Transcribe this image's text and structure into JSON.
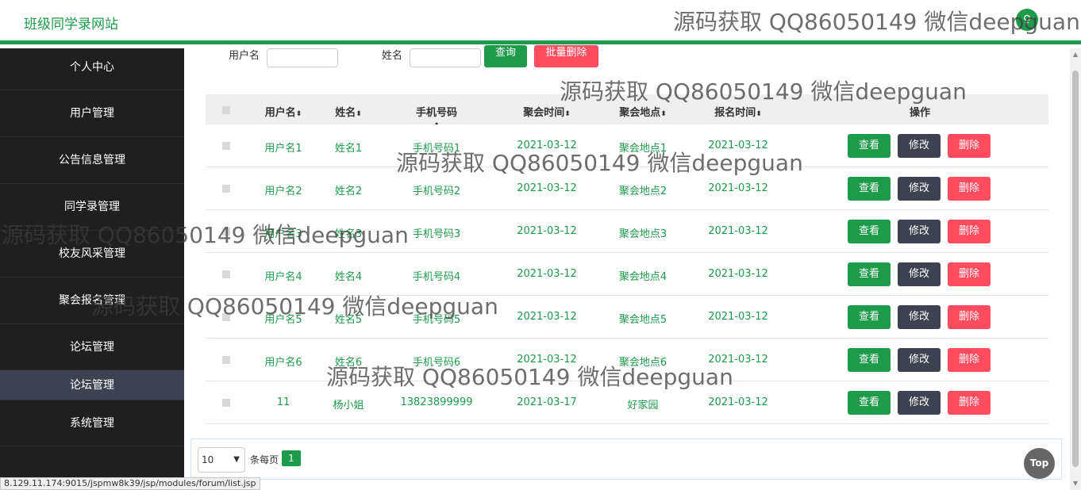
{
  "header": {
    "site_title": "班级同学录网站",
    "avatar_glyph": "♀"
  },
  "sidebar": {
    "items": [
      {
        "label": "个人中心"
      },
      {
        "label": "用户管理"
      },
      {
        "label": "公告信息管理"
      },
      {
        "label": "同学录管理"
      },
      {
        "label": "校友风采管理"
      },
      {
        "label": "聚会报名管理"
      },
      {
        "label": "论坛管理"
      },
      {
        "label": "论坛管理",
        "sub": true
      },
      {
        "label": "系统管理"
      }
    ]
  },
  "search": {
    "username_label": "用户名",
    "name_label": "姓名",
    "username_value": "",
    "name_value": "",
    "query_button": "查询",
    "batch_delete_button": "批量删除"
  },
  "table": {
    "headers": [
      "用户名",
      "姓名",
      "手机号码",
      "聚会时间",
      "聚会地点",
      "报名时间",
      "操作"
    ],
    "sort_icon": "sort-icon",
    "rows": [
      [
        "用户名1",
        "姓名1",
        "手机号码1",
        "2021-03-12",
        "聚会地点1",
        "2021-03-12"
      ],
      [
        "用户名2",
        "姓名2",
        "手机号码2",
        "2021-03-12",
        "聚会地点2",
        "2021-03-12"
      ],
      [
        "用户名3",
        "姓名3",
        "手机号码3",
        "2021-03-12",
        "聚会地点3",
        "2021-03-12"
      ],
      [
        "用户名4",
        "姓名4",
        "手机号码4",
        "2021-03-12",
        "聚会地点4",
        "2021-03-12"
      ],
      [
        "用户名5",
        "姓名5",
        "手机号码5",
        "2021-03-12",
        "聚会地点5",
        "2021-03-12"
      ],
      [
        "用户名6",
        "姓名6",
        "手机号码6",
        "2021-03-12",
        "聚会地点6",
        "2021-03-12"
      ],
      [
        "11",
        "杨小姐",
        "13823899999",
        "2021-03-17",
        "好家园",
        "2021-03-12"
      ]
    ],
    "actions": {
      "view": "查看",
      "edit": "修改",
      "delete": "删除"
    }
  },
  "pager": {
    "page_size": "10",
    "per_page_label": "条每页",
    "current_page": "1"
  },
  "top_button": "Top",
  "status_url": "8.129.11.174:9015/jspmw8k39/jsp/modules/forum/list.jsp",
  "watermark_text": "源码获取 QQ86050149 微信deepguan",
  "colors": {
    "brand": "#1d9a4a",
    "sidebar_bg": "#1f1f1f",
    "edit": "#3c4250",
    "delete": "#ff4d5f"
  }
}
